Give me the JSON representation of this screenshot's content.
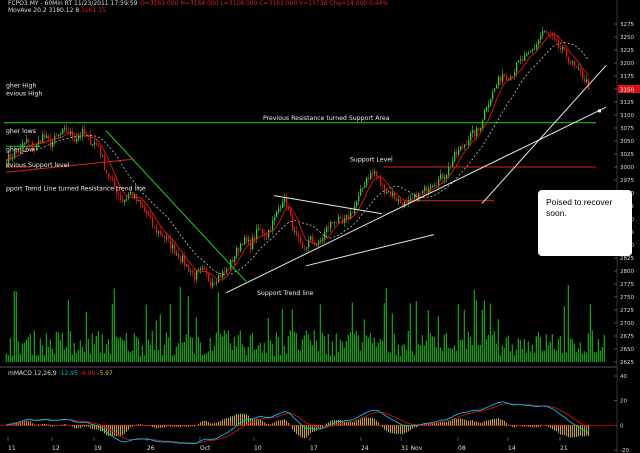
{
  "header": {
    "symbol_line": "FCPO3.MY - 60Min RT   11/23/2011   17:59:59",
    "ohlc": [
      "O=3161.000",
      "H=3164.000",
      "L=3126.000",
      "C=3161.000",
      "V=13736",
      "Chg=14.000",
      "0.44%"
    ],
    "ma_label": "MovAve 20.2",
    "ma_vals": [
      "3180.12",
      "8",
      "3161.15"
    ]
  },
  "macd_header": {
    "name": "mMACD 12,26,9",
    "v1": "-12.95",
    "v2": "-6.99",
    "v3": "-5.97"
  },
  "annotations": {
    "prev_resist": "Previous Resistance turned Support Area",
    "support_level": "Support Level",
    "support_trend": "Support Trend line",
    "trend_resist": "pport Trend Line turned Resistance trend line",
    "left_high_a": "gher High",
    "left_high_b": "evious High",
    "left_lows": "gher lows",
    "left_low": "gher Low",
    "left_support": "evious Support level"
  },
  "callout": {
    "line1": "Poised to recover",
    "line2": "soon."
  },
  "colors": {
    "bg": "#000000",
    "up": "#33cc33",
    "down": "#e01818",
    "volume": "#22dd22",
    "trend_green": "#22cc22",
    "trend_red": "#dd2222",
    "trend_white": "#e8e8e8",
    "macd": "#00bbee",
    "signal": "#cc1111",
    "hist": "#ddbb00",
    "last_price_tag": "#dd1111"
  },
  "chart_data": {
    "type": "candlestick",
    "y_axis": {
      "min": 2625,
      "max": 3275,
      "ticks": [
        3275,
        3250,
        3225,
        3200,
        3175,
        3150,
        3125,
        3100,
        3075,
        3050,
        3025,
        3000,
        2975,
        2950,
        2925,
        2900,
        2875,
        2850,
        2825,
        2800,
        2775,
        2750,
        2725,
        2700,
        2675,
        2650,
        2625
      ]
    },
    "last_price": 3150,
    "x_tick_labels": [
      "11",
      "12",
      "19",
      "26",
      "Oct",
      "10",
      "17",
      "24",
      "31 Nov",
      "08",
      "14",
      "21"
    ],
    "close_path": [
      [
        0,
        3015
      ],
      [
        6,
        3030
      ],
      [
        10,
        3050
      ],
      [
        14,
        3035
      ],
      [
        18,
        3060
      ],
      [
        22,
        3045
      ],
      [
        26,
        3060
      ],
      [
        30,
        3070
      ],
      [
        34,
        3055
      ],
      [
        38,
        3065
      ],
      [
        42,
        3050
      ],
      [
        46,
        3040
      ],
      [
        50,
        2990
      ],
      [
        54,
        2960
      ],
      [
        58,
        2935
      ],
      [
        62,
        2950
      ],
      [
        66,
        2930
      ],
      [
        70,
        2910
      ],
      [
        74,
        2880
      ],
      [
        78,
        2870
      ],
      [
        82,
        2850
      ],
      [
        86,
        2830
      ],
      [
        90,
        2810
      ],
      [
        94,
        2790
      ],
      [
        98,
        2800
      ],
      [
        102,
        2780
      ],
      [
        106,
        2790
      ],
      [
        110,
        2800
      ],
      [
        114,
        2830
      ],
      [
        118,
        2860
      ],
      [
        122,
        2850
      ],
      [
        126,
        2880
      ],
      [
        130,
        2870
      ],
      [
        134,
        2900
      ],
      [
        138,
        2940
      ],
      [
        140,
        2930
      ],
      [
        144,
        2870
      ],
      [
        148,
        2840
      ],
      [
        152,
        2860
      ],
      [
        156,
        2850
      ],
      [
        160,
        2880
      ],
      [
        164,
        2900
      ],
      [
        168,
        2890
      ],
      [
        172,
        2910
      ],
      [
        176,
        2940
      ],
      [
        180,
        2980
      ],
      [
        184,
        2990
      ],
      [
        188,
        2960
      ],
      [
        192,
        2950
      ],
      [
        196,
        2935
      ],
      [
        200,
        2925
      ],
      [
        204,
        2940
      ],
      [
        208,
        2950
      ],
      [
        212,
        2970
      ],
      [
        216,
        2975
      ],
      [
        220,
        2990
      ],
      [
        224,
        3020
      ],
      [
        228,
        3040
      ],
      [
        232,
        3060
      ],
      [
        236,
        3070
      ],
      [
        240,
        3120
      ],
      [
        244,
        3150
      ],
      [
        248,
        3180
      ],
      [
        252,
        3175
      ],
      [
        256,
        3200
      ],
      [
        260,
        3210
      ],
      [
        264,
        3230
      ],
      [
        268,
        3260
      ],
      [
        272,
        3250
      ],
      [
        276,
        3230
      ],
      [
        280,
        3215
      ],
      [
        284,
        3190
      ],
      [
        288,
        3175
      ],
      [
        292,
        3150
      ]
    ],
    "levels": {
      "prev_resist_support": 3085,
      "support_level": 3000,
      "red_short_level": 2935
    },
    "trend_lines": [
      {
        "name": "downtrend",
        "points": [
          [
            50,
            3070
          ],
          [
            120,
            2780
          ]
        ]
      },
      {
        "name": "support_trend_main",
        "points": [
          [
            110,
            2758
          ],
          [
            300,
            3115
          ]
        ]
      },
      {
        "name": "support_trend_outer",
        "points": [
          [
            238,
            2930
          ],
          [
            300,
            3195
          ]
        ]
      },
      {
        "name": "minor_support",
        "points": [
          [
            150,
            2810
          ],
          [
            214,
            2870
          ]
        ]
      },
      {
        "name": "triangle_top",
        "points": [
          [
            134,
            2945
          ],
          [
            188,
            2910
          ]
        ]
      },
      {
        "name": "left_red_trend",
        "points": [
          [
            0,
            2990
          ],
          [
            64,
            3015
          ]
        ]
      }
    ],
    "macd": {
      "range": [
        -20,
        40
      ],
      "ticks": [
        40,
        20,
        0,
        -20
      ]
    },
    "volume": {
      "count": 300
    }
  }
}
